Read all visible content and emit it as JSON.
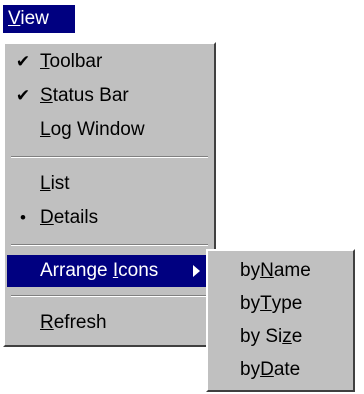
{
  "menubar": {
    "view_label_ul": "V",
    "view_label_rest": "iew"
  },
  "menu": {
    "toolbar": {
      "ul": "T",
      "rest": "oolbar",
      "check": "✔"
    },
    "statusbar": {
      "ul": "S",
      "rest": "tatus Bar",
      "check": "✔"
    },
    "logwindow": {
      "ul": "L",
      "rest": "og Window"
    },
    "list": {
      "ul": "L",
      "rest": "ist"
    },
    "details": {
      "ul": "D",
      "rest": "etails",
      "bullet": "•"
    },
    "arrange": {
      "pre": "Arrange ",
      "ul": "I",
      "rest": "cons"
    },
    "refresh": {
      "ul": "R",
      "rest": "efresh"
    }
  },
  "submenu": {
    "by_name": {
      "pre": "by ",
      "ul": "N",
      "rest": "ame"
    },
    "by_type": {
      "pre": "by ",
      "ul": "T",
      "rest": "ype"
    },
    "by_size": {
      "pre": "by Si",
      "ul": "z",
      "rest": "e"
    },
    "by_date": {
      "pre": "by ",
      "ul": "D",
      "rest": "ate"
    }
  },
  "colors": {
    "menu_bg": "#c0c0c0",
    "highlight": "#000080"
  }
}
